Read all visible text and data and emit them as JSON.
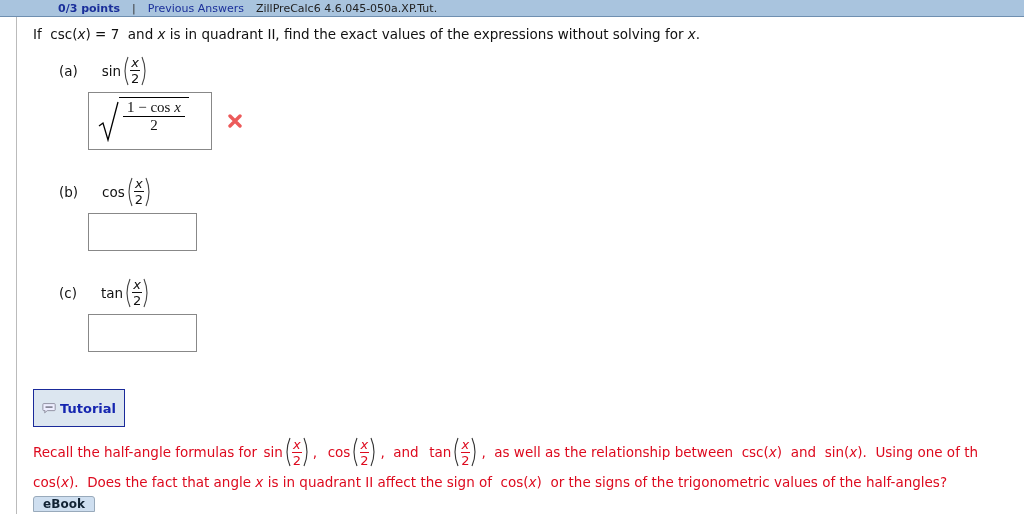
{
  "header": {
    "score": "0/3 points",
    "separator": "|",
    "link": "Previous Answers",
    "code": "ZillPreCalc6 4.6.045-050a.XP.Tut."
  },
  "question": "If  csc(*x*) = 7  and *x* is in quadrant II, find the exact values of the expressions without solving for *x*.",
  "parts": [
    {
      "label": "(a)",
      "fn": "sin",
      "num": "x",
      "den": "2",
      "answer": {
        "kind": "radical",
        "num": "1 − cos *x*",
        "den": "2"
      },
      "wrong": true
    },
    {
      "label": "(b)",
      "fn": "cos",
      "num": "x",
      "den": "2",
      "wrong": false
    },
    {
      "label": "(c)",
      "fn": "tan",
      "num": "x",
      "den": "2",
      "wrong": false
    }
  ],
  "tutorial": "Tutorial",
  "hint": [
    [
      {
        "kind": "text",
        "text": "Recall the half-angle formulas for "
      },
      {
        "kind": "half",
        "fn": "sin",
        "num": "x",
        "den": "2"
      },
      {
        "kind": "text",
        "text": ",  "
      },
      {
        "kind": "half",
        "fn": "cos",
        "num": "x",
        "den": "2"
      },
      {
        "kind": "text",
        "text": ",  and  "
      },
      {
        "kind": "half",
        "fn": "tan",
        "num": "x",
        "den": "2"
      },
      {
        "kind": "text",
        "text": ",  as well as the relationship between  csc(*x*)  and  sin(*x*).  Using one of th"
      }
    ],
    [
      {
        "kind": "text",
        "text": "cos(*x*).  Does the fact that angle *x* is in quadrant II affect the sign of  cos(*x*)  or the signs of the trigonometric values of the half-angles?"
      }
    ]
  ],
  "ebook": "eBook"
}
